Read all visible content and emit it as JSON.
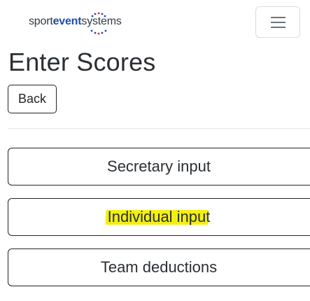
{
  "navbar": {
    "logo": {
      "part1": "sport",
      "part2": "event",
      "part3": "systems",
      "dot_color": "#1e4fa6",
      "dot_accent_color": "#e4242b"
    },
    "menu_icon": "hamburger-icon"
  },
  "page": {
    "title": "Enter Scores",
    "back_label": "Back"
  },
  "options": [
    {
      "label": "Secretary input",
      "highlighted": false
    },
    {
      "label": "Individual input",
      "highlighted": true,
      "highlight_color": "#f3ef12"
    },
    {
      "label": "Team deductions",
      "highlighted": false
    }
  ]
}
